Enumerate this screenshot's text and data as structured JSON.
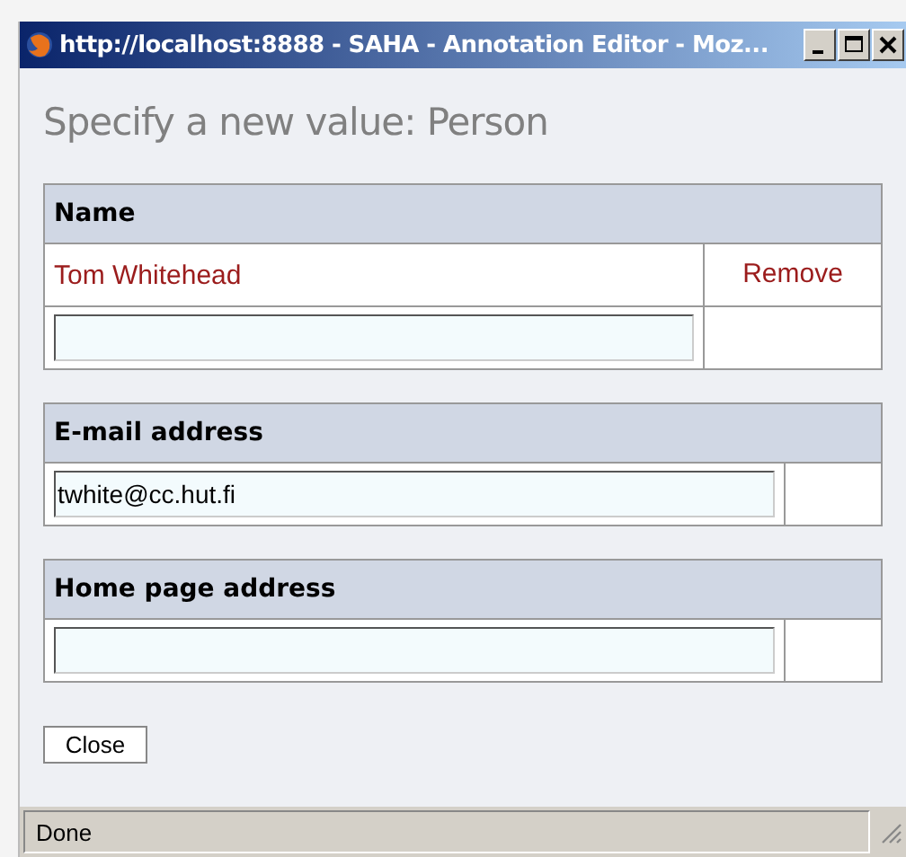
{
  "window": {
    "title": "http://localhost:8888 - SAHA - Annotation Editor - Moz..."
  },
  "heading": "Specify a new value: Person",
  "sections": [
    {
      "label": "Name",
      "kind": "value_list",
      "values": [
        {
          "text": "Tom Whitehead",
          "action": "Remove"
        }
      ]
    },
    {
      "label": "E-mail address",
      "kind": "single",
      "field": {
        "value": "twhite@cc.hut.fi"
      }
    },
    {
      "label": "Home page address",
      "kind": "single"
    }
  ],
  "close_button": "Close",
  "status_bar": "Done"
}
